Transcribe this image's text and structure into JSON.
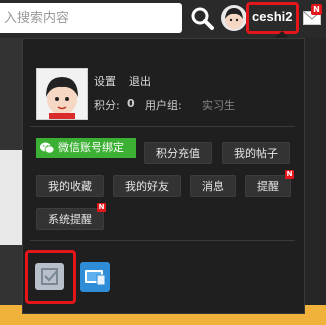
{
  "header": {
    "search_placeholder": "入搜索内容",
    "username": "ceshi2",
    "mail_badge": "N"
  },
  "profile": {
    "settings_label": "设置",
    "logout_label": "退出",
    "points_label": "积分:",
    "points_value": "0",
    "group_label": "用户组:",
    "group_value": "实习生"
  },
  "actions": {
    "wechat_bind": "微信账号绑定",
    "recharge": "积分充值",
    "my_posts": "我的帖子",
    "favorites": "我的收藏",
    "friends": "我的好友",
    "messages": "消息",
    "reminders": "提醒",
    "reminders_badge": "N",
    "system_reminders": "系统提醒",
    "system_reminders_badge": "N"
  },
  "apps": {
    "app1_icon": "checkin-icon",
    "app2_icon": "tablet-app-icon"
  },
  "colors": {
    "accent_red": "#e3161b",
    "wechat_green": "#3cb034",
    "panel_bg": "#1f1f1f"
  }
}
